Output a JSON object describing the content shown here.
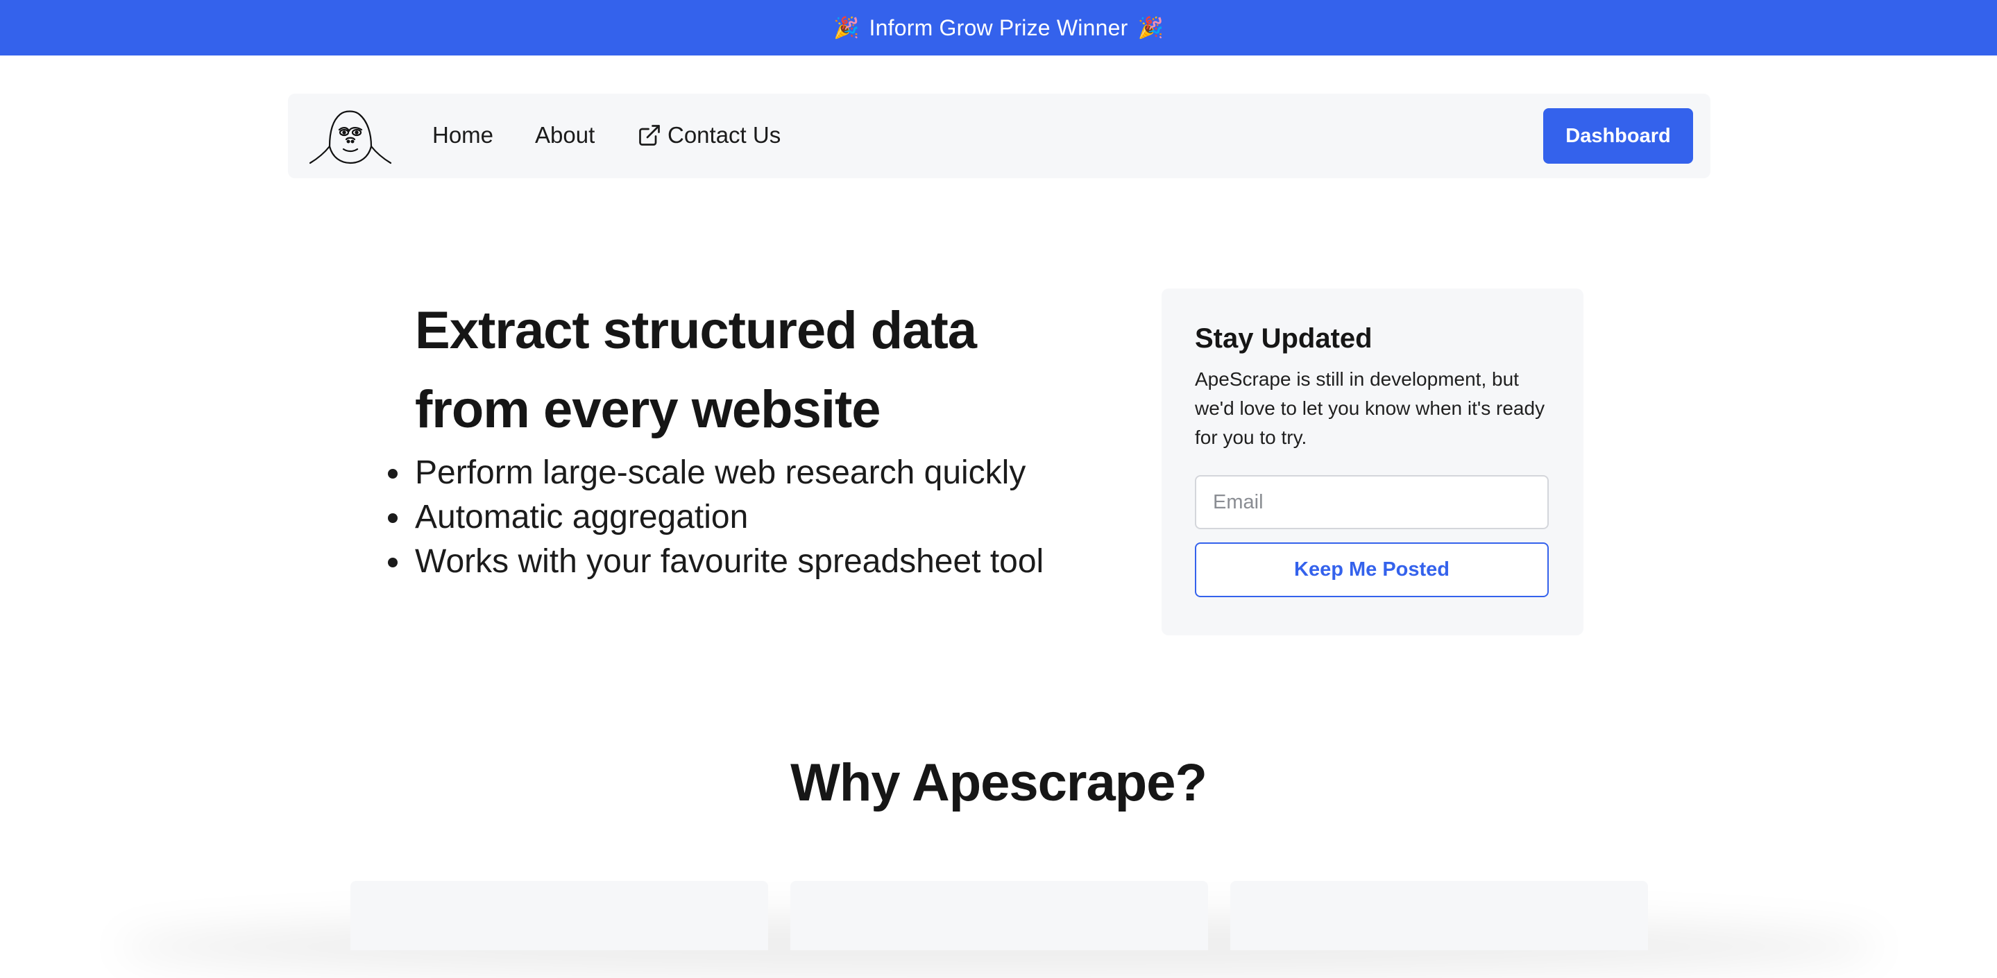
{
  "banner": {
    "text": "Inform Grow Prize Winner",
    "icon": "party-popper-icon"
  },
  "nav": {
    "logo": "gorilla-logo",
    "links": [
      "Home",
      "About",
      "Contact Us"
    ],
    "contact_icon": "external-link-icon",
    "dashboard_label": "Dashboard"
  },
  "hero": {
    "title_line1": "Extract structured data",
    "title_line2_prefix": "from ",
    "title_line2_em": "every",
    "title_line2_suffix": " website",
    "bullets": [
      "Perform large-scale web research quickly",
      "Automatic aggregation",
      "Works with your favourite spreadsheet tool"
    ]
  },
  "signup": {
    "title": "Stay Updated",
    "description": "ApeScrape is still in development, but we'd love to let you know when it's ready for you to try.",
    "email_placeholder": "Email",
    "button_label": "Keep Me Posted"
  },
  "why": {
    "title": "Why Apescrape?"
  },
  "colors": {
    "accent": "#3462ec",
    "panel": "#f6f7f9",
    "text": "#161616"
  }
}
